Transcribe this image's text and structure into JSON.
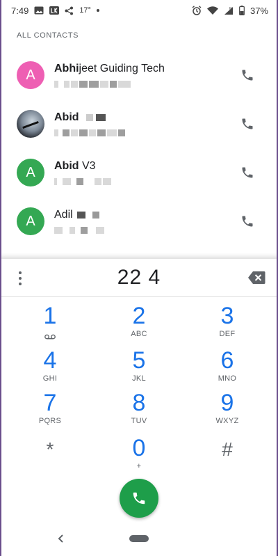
{
  "status_bar": {
    "time": "7:49",
    "temperature": "17°",
    "battery": "37%"
  },
  "contacts": {
    "section_title": "ALL CONTACTS",
    "items": [
      {
        "initial": "A",
        "name_bold": "Abhi",
        "name_rest": "jeet Guiding Tech",
        "avatar_color": "#ee5fb3"
      },
      {
        "initial": "",
        "name_bold": "Abid",
        "name_rest": "",
        "avatar_color": "#2a2e35"
      },
      {
        "initial": "A",
        "name_bold": "Abid",
        "name_rest": " V3",
        "avatar_color": "#34a853"
      },
      {
        "initial": "A",
        "name_bold": "",
        "name_rest": "Adil",
        "avatar_color": "#34a853"
      }
    ]
  },
  "dialpad": {
    "digits": "22 4",
    "keys": [
      {
        "digit": "1",
        "sub": ""
      },
      {
        "digit": "2",
        "sub": "ABC"
      },
      {
        "digit": "3",
        "sub": "DEF"
      },
      {
        "digit": "4",
        "sub": "GHI"
      },
      {
        "digit": "5",
        "sub": "JKL"
      },
      {
        "digit": "6",
        "sub": "MNO"
      },
      {
        "digit": "7",
        "sub": "PQRS"
      },
      {
        "digit": "8",
        "sub": "TUV"
      },
      {
        "digit": "9",
        "sub": "WXYZ"
      },
      {
        "digit": "*",
        "sub": ""
      },
      {
        "digit": "0",
        "sub": "+"
      },
      {
        "digit": "#",
        "sub": ""
      }
    ]
  },
  "icons": {
    "call": "phone-icon",
    "voicemail": "voicemail-icon",
    "backspace": "backspace-icon",
    "more": "more-vert-icon"
  },
  "colors": {
    "accent_blue": "#1a73e8",
    "call_green": "#1e9e4a",
    "avatar_pink": "#ee5fb3",
    "avatar_green": "#34a853"
  }
}
